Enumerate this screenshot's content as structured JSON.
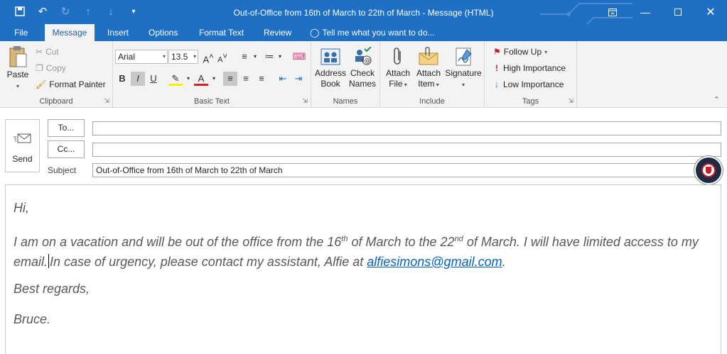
{
  "window": {
    "title": "Out-of-Office from 16th of March to 22th of March  -  Message (HTML)"
  },
  "tabs": [
    {
      "label": "File"
    },
    {
      "label": "Message"
    },
    {
      "label": "Insert"
    },
    {
      "label": "Options"
    },
    {
      "label": "Format Text"
    },
    {
      "label": "Review"
    },
    {
      "label": "Tell me what you want to do..."
    }
  ],
  "ribbon": {
    "clipboard": {
      "paste": "Paste",
      "cut": "Cut",
      "copy": "Copy",
      "format_painter": "Format Painter",
      "label": "Clipboard"
    },
    "basic_text": {
      "font": "Arial",
      "size": "13.5",
      "label": "Basic Text"
    },
    "names": {
      "address_book_1": "Address",
      "address_book_2": "Book",
      "check_names_1": "Check",
      "check_names_2": "Names",
      "label": "Names"
    },
    "include": {
      "attach_file_1": "Attach",
      "attach_file_2": "File",
      "attach_item_1": "Attach",
      "attach_item_2": "Item",
      "signature": "Signature",
      "label": "Include"
    },
    "tags": {
      "follow_up": "Follow Up",
      "high_importance": "High Importance",
      "low_importance": "Low Importance",
      "label": "Tags"
    }
  },
  "compose": {
    "send": "Send",
    "to_button": "To...",
    "cc_button": "Cc...",
    "to_value": "",
    "cc_value": "",
    "subject_label": "Subject",
    "subject_value": "Out-of-Office from 16th of March to 22th of March"
  },
  "body": {
    "greeting": "Hi,",
    "line1_a": "I am on a vacation and will be out of the office from the 16",
    "line1_sup1": "th",
    "line1_b": " of March to the 22",
    "line1_sup2": "nd",
    "line1_c": " of March. I will have limited access to my",
    "line2_a": "email.",
    "line2_b": "In case of urgency, please contact my assistant, Alfie at ",
    "email": "alfiesimons@gmail.com",
    "line2_c": ".",
    "closing": "Best regards,",
    "signature": "Bruce."
  },
  "colors": {
    "accent": "#1f6fc5",
    "link": "#0563c1",
    "body_text": "#595959"
  }
}
